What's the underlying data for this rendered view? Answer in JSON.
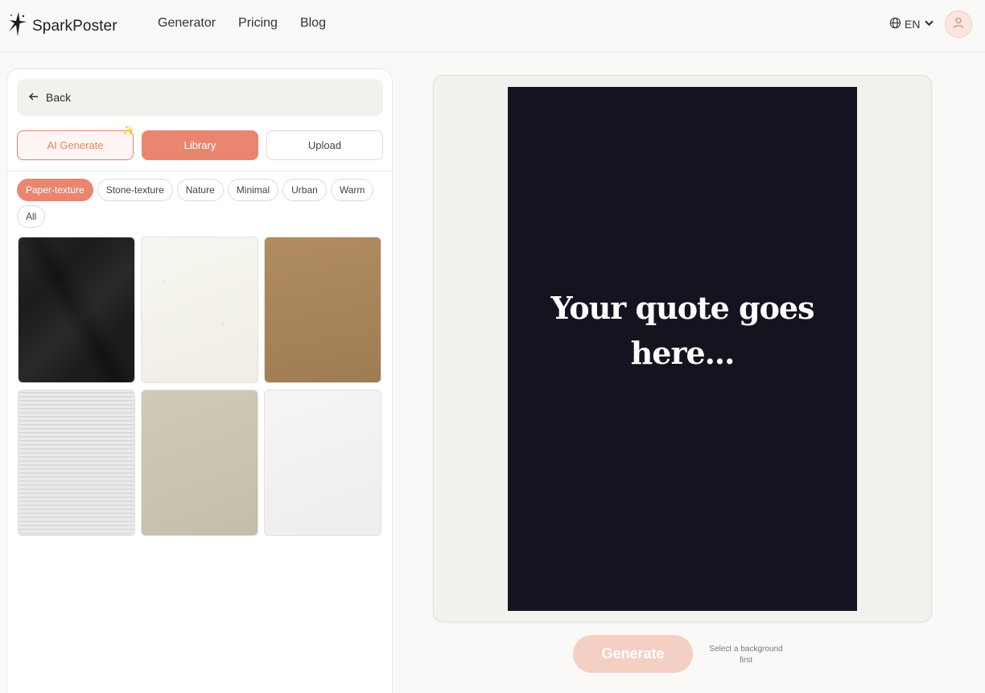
{
  "header": {
    "brand": "SparkPoster",
    "nav": [
      "Generator",
      "Pricing",
      "Blog"
    ],
    "language": "EN"
  },
  "panel": {
    "back_label": "Back",
    "tabs": {
      "ai_generate": "AI Generate",
      "library": "Library",
      "upload": "Upload"
    },
    "active_tab": "Library",
    "categories": [
      "Paper-texture",
      "Stone-texture",
      "Nature",
      "Minimal",
      "Urban",
      "Warm",
      "All"
    ],
    "active_category": "Paper-texture",
    "textures": [
      {
        "name": "black-crumpled-paper",
        "color": "#1b1c1b"
      },
      {
        "name": "off-white-speckled-paper",
        "color": "#f4f2ea"
      },
      {
        "name": "kraft-brown-paper",
        "color": "#a7845a"
      },
      {
        "name": "grey-fabric-paper",
        "color": "#dedede"
      },
      {
        "name": "beige-recycled-paper",
        "color": "#cbc5b2"
      },
      {
        "name": "white-fine-paper",
        "color": "#f4f2f0"
      }
    ]
  },
  "preview": {
    "quote": "Your quote goes here...",
    "poster_color": "#131420"
  },
  "actions": {
    "generate_label": "Generate",
    "hint": "Select a background first"
  },
  "colors": {
    "accent": "#ea8570",
    "accent_light": "#f3cfc4",
    "background": "#faf9f7"
  }
}
